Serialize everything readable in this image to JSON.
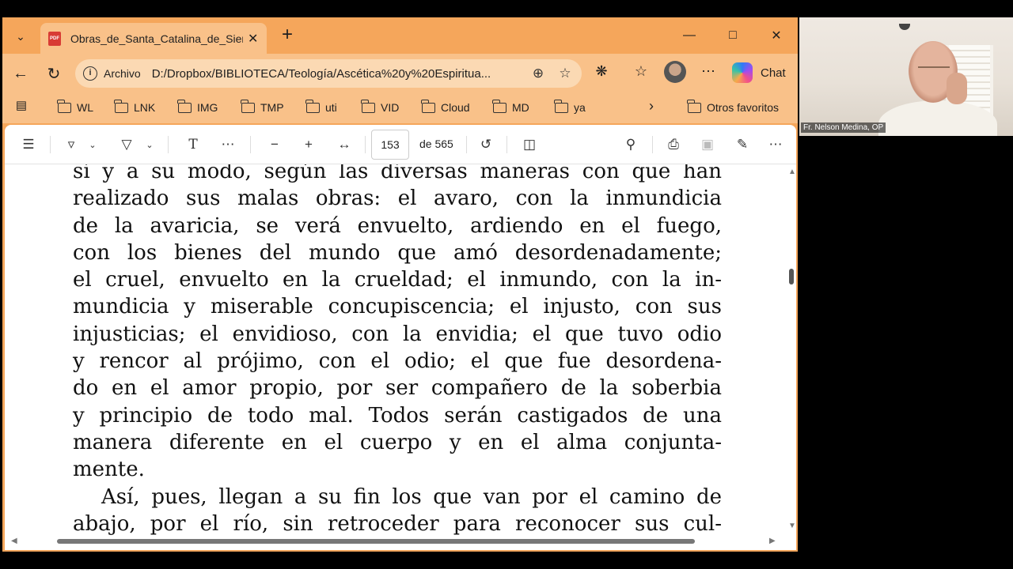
{
  "tab": {
    "title": "Obras_de_Santa_Catalina_de_Siena",
    "icon_text": "PDF"
  },
  "address": {
    "label": "Archivo",
    "url": "D:/Dropbox/BIBLIOTECA/Teología/Ascética%20y%20Espiritua..."
  },
  "copilot": {
    "label": "Chat"
  },
  "favorites": [
    "WL",
    "LNK",
    "IMG",
    "TMP",
    "uti",
    "VID",
    "Cloud",
    "MD",
    "ya"
  ],
  "other_favorites": "Otros favoritos",
  "pdf_toolbar": {
    "page_current": "153",
    "page_total": "de 565"
  },
  "pdf_lines": [
    "sí y a su modo, según las diversas maneras con que han",
    "realizado sus malas obras: el avaro, con la inmundicia",
    "de la avaricia, se verá envuelto, ardiendo en el fuego,",
    "con los bienes del mundo que amó desordenadamente;",
    "el cruel, envuelto en la crueldad; el inmundo, con la in-",
    "mundicia y miserable concupiscencia; el injusto, con sus",
    "injusticias; el envidioso, con la envidia; el que tuvo odio",
    "y rencor al prójimo, con el odio; el que fue desordena-",
    "do en el amor propio, por ser compañero de la soberbia",
    "y principio de todo mal. Todos serán castigados de una",
    "manera diferente en el cuerpo y en el alma conjunta-",
    "mente.",
    "Así, pues, llegan a su fin los que van por el camino de",
    "abajo, por el río, sin retroceder para reconocer sus cul-"
  ],
  "webcam": {
    "name": "Fr. Nelson Medina, OP"
  }
}
